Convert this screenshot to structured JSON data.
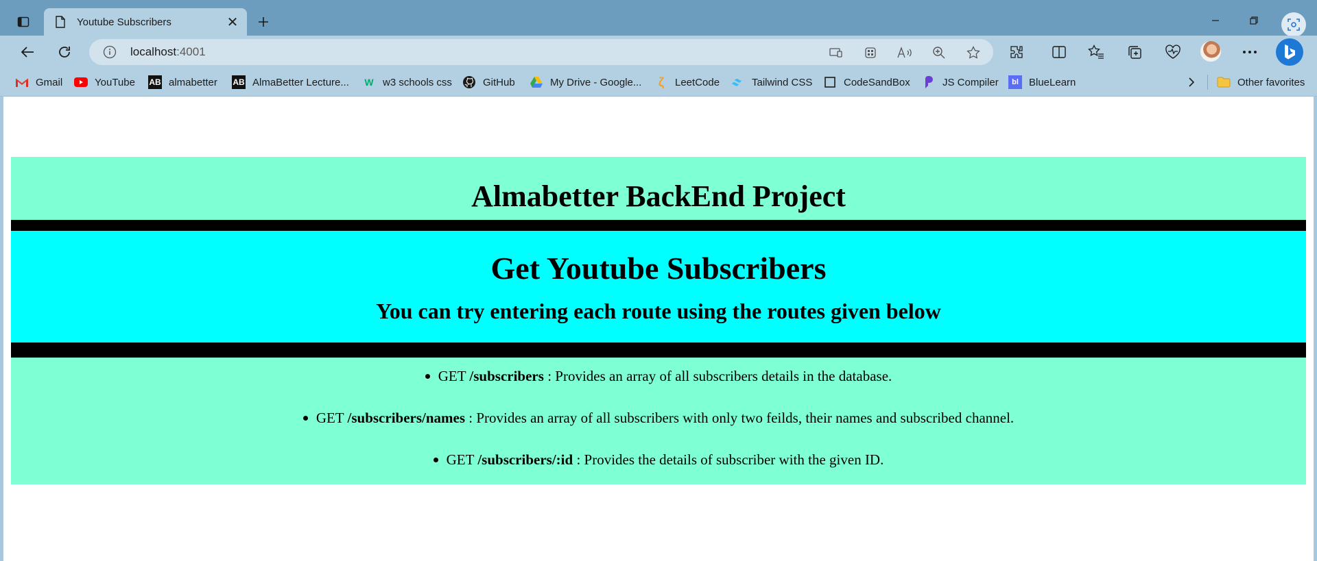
{
  "browser": {
    "tab": {
      "title": "Youtube Subscribers",
      "close": "✕"
    },
    "new_tab": "+",
    "window_controls": {
      "minimize": "—",
      "restore": "❐"
    },
    "address_bar": {
      "host": "localhost",
      "port": ":4001"
    },
    "bookmarks": [
      {
        "label": "Gmail",
        "icon": "gmail-icon"
      },
      {
        "label": "YouTube",
        "icon": "youtube-icon"
      },
      {
        "label": "almabetter",
        "icon": "ab-icon"
      },
      {
        "label": "AlmaBetter Lecture...",
        "icon": "ab-icon"
      },
      {
        "label": "w3 schools css",
        "icon": "w3-icon"
      },
      {
        "label": "GitHub",
        "icon": "github-icon"
      },
      {
        "label": "My Drive - Google...",
        "icon": "drive-icon"
      },
      {
        "label": "LeetCode",
        "icon": "leetcode-icon"
      },
      {
        "label": "Tailwind CSS",
        "icon": "tailwind-icon"
      },
      {
        "label": "CodeSandBox",
        "icon": "codesandbox-icon"
      },
      {
        "label": "JS Compiler",
        "icon": "js-compiler-icon"
      },
      {
        "label": "BlueLearn",
        "icon": "bluelearn-icon"
      }
    ],
    "other_favorites": "Other favorites",
    "colors": {
      "tabbar": "#6c9dbf",
      "toolbar": "#b3d0e3",
      "address": "#d3e3ee"
    }
  },
  "page": {
    "header_title": "Almabetter BackEnd Project",
    "main_title": "Get Youtube Subscribers",
    "subtitle": "You can try entering each route using the routes given below",
    "routes": [
      {
        "method": "GET",
        "path": "/subscribers",
        "desc": ": Provides an array of all subscribers details in the database."
      },
      {
        "method": "GET",
        "path": "/subscribers/names",
        "desc": ": Provides an array of all subscribers with only two feilds, their names and subscribed channel."
      },
      {
        "method": "GET",
        "path": "/subscribers/:id",
        "desc": ": Provides the details of subscriber with the given ID."
      }
    ],
    "colors": {
      "aquamarine": "#7fffd4",
      "cyan": "#00ffff",
      "divider": "#000000"
    }
  }
}
